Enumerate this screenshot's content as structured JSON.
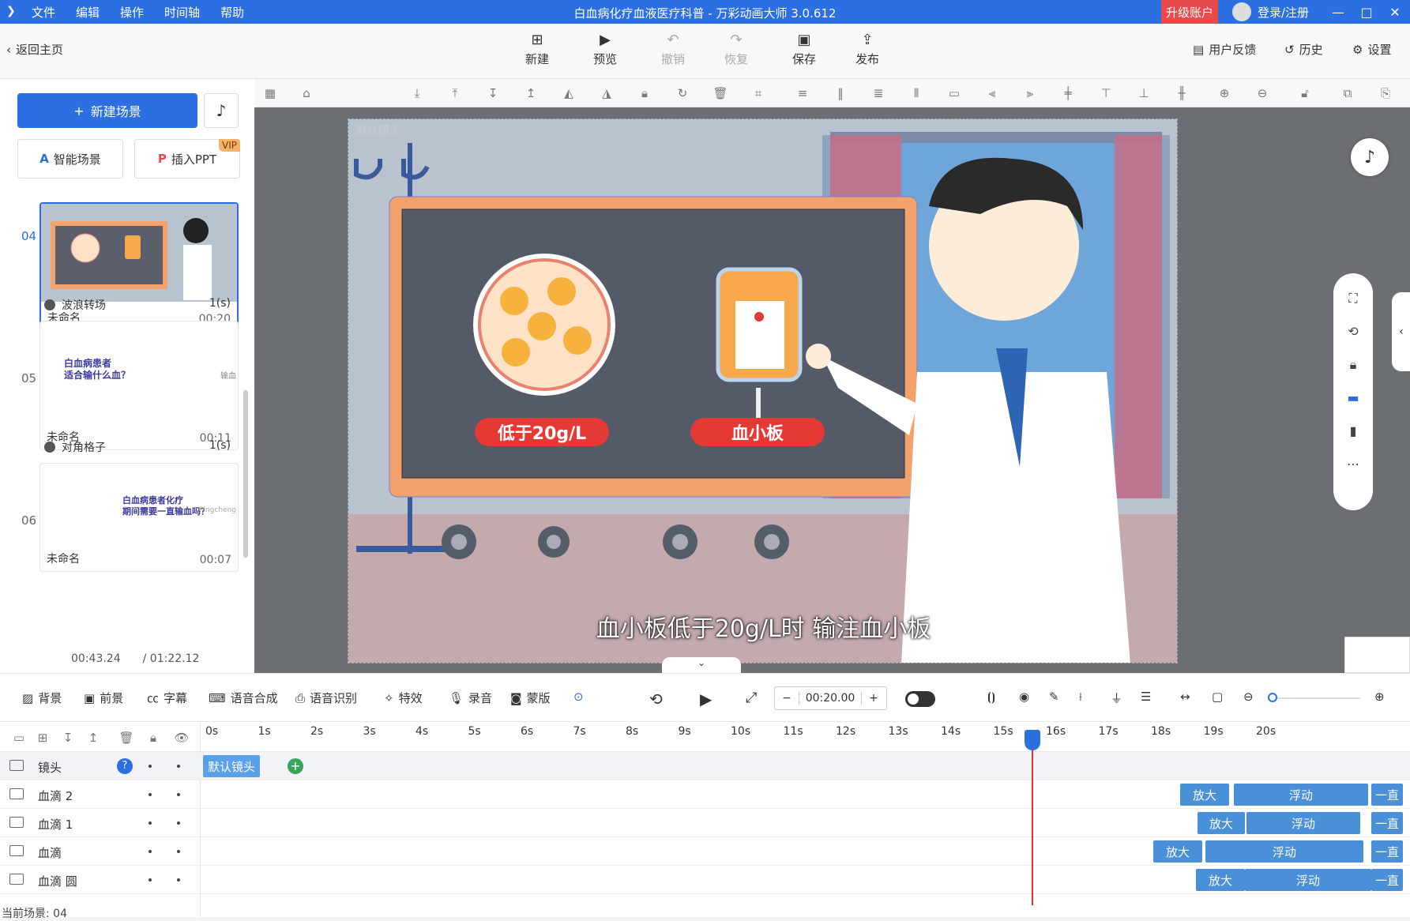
{
  "titlebar": {
    "menu": [
      "文件",
      "编辑",
      "操作",
      "时间轴",
      "帮助"
    ],
    "title": "白血病化疗血液医疗科普 - 万彩动画大师 3.0.612",
    "upgrade": "升级账户",
    "login": "登录/注册"
  },
  "toolbar": {
    "back": "返回主页",
    "buttons": [
      "新建",
      "预览",
      "撤销",
      "恢复",
      "保存",
      "发布"
    ],
    "right": [
      "用户反馈",
      "历史",
      "设置"
    ]
  },
  "left": {
    "new_scene": "新建场景",
    "smart_scene": "智能场景",
    "insert_ppt": "插入PPT",
    "vip": "VIP",
    "scenes": [
      {
        "no": "04",
        "name": "未命名",
        "dur": "00:20"
      },
      {
        "no": "05",
        "name": "未命名",
        "dur": "00:11",
        "thumb_text": "白血病患者\n适合输什么血？",
        "side_text": "输血"
      },
      {
        "no": "06",
        "name": "未命名",
        "dur": "00:07",
        "thumb_text": "白血病患者化疗\n期间需要一直输血吗？",
        "side_text": "Pingcheng"
      }
    ],
    "transitions": [
      {
        "name": "波浪转场",
        "dur": "1(s)"
      },
      {
        "name": "对角格子",
        "dur": "1(s)"
      }
    ],
    "time_current": "00:43.24",
    "time_total": "/ 01:22.12"
  },
  "stage": {
    "camera_label": "默认镜头",
    "label_left": "低于20g/L",
    "label_right": "血小板",
    "subtitle": "血小板低于20g/L时 输注血小板"
  },
  "tltools": {
    "left": [
      "背景",
      "前景",
      "字幕",
      "语音合成",
      "语音识别",
      "特效",
      "录音",
      "蒙版"
    ],
    "time": "00:20.00",
    "minus": "−",
    "plus": "+"
  },
  "timeline": {
    "ticks": [
      "0s",
      "1s",
      "2s",
      "3s",
      "4s",
      "5s",
      "6s",
      "7s",
      "8s",
      "9s",
      "10s",
      "11s",
      "12s",
      "13s",
      "14s",
      "15s",
      "16s",
      "17s",
      "18s",
      "19s",
      "20s"
    ],
    "camera_track": "镜头",
    "camera_clip": "默认镜头",
    "tracks": [
      {
        "name": "血滴 2",
        "clips": [
          "放大",
          "浮动",
          "一直"
        ]
      },
      {
        "name": "血滴 1",
        "clips": [
          "放大",
          "浮动",
          "一直"
        ]
      },
      {
        "name": "血滴",
        "clips": [
          "放大",
          "浮动",
          "一直"
        ]
      },
      {
        "name": "血滴 圆",
        "clips": [
          "放大",
          "浮动",
          "一直"
        ]
      }
    ],
    "current_scene": "当前场景: 04"
  },
  "colors": {
    "accent": "#2b6fe0",
    "upgrade": "#e94b4b",
    "clip": "#4a90d9",
    "playhead": "#d33"
  }
}
